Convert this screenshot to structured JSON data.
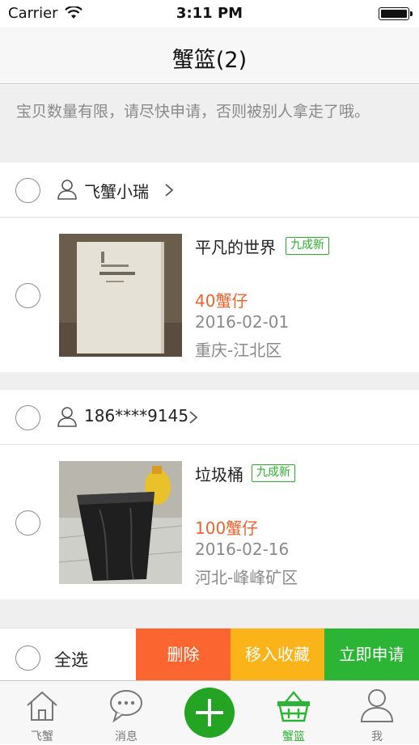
{
  "status_bar": {
    "carrier": "Carrier",
    "time": "3:11 PM"
  },
  "nav": {
    "title": "蟹篮(2)"
  },
  "notice": {
    "text": "宝贝数量有限，请尽快申请，否则被别人拿走了哦。"
  },
  "groups": [
    {
      "seller": "飞蟹小瑞",
      "item": {
        "title": "平凡的世界",
        "condition": "九成新",
        "price": "40蟹仔",
        "date": "2016-02-01",
        "location": "重庆-江北区"
      }
    },
    {
      "seller": "186****9145",
      "item": {
        "title": "垃圾桶",
        "condition": "九成新",
        "price": "100蟹仔",
        "date": "2016-02-16",
        "location": "河北-峰峰矿区"
      }
    }
  ],
  "action_bar": {
    "select_all": "全选",
    "delete": "删除",
    "move_to_favorites": "移入收藏",
    "apply_now": "立即申请"
  },
  "tab_bar": {
    "tabs": [
      {
        "label": "飞蟹",
        "icon": "home-icon"
      },
      {
        "label": "消息",
        "icon": "chat-bubble-icon"
      },
      {
        "label": "",
        "icon": "plus-icon"
      },
      {
        "label": "蟹篮",
        "icon": "basket-icon",
        "active": true
      },
      {
        "label": "我",
        "icon": "user-icon"
      }
    ]
  },
  "colors": {
    "accent_green": "#2cb535",
    "price_orange": "#f0632a",
    "delete_orange": "#fb6530",
    "favorite_yellow": "#fbb31a"
  }
}
